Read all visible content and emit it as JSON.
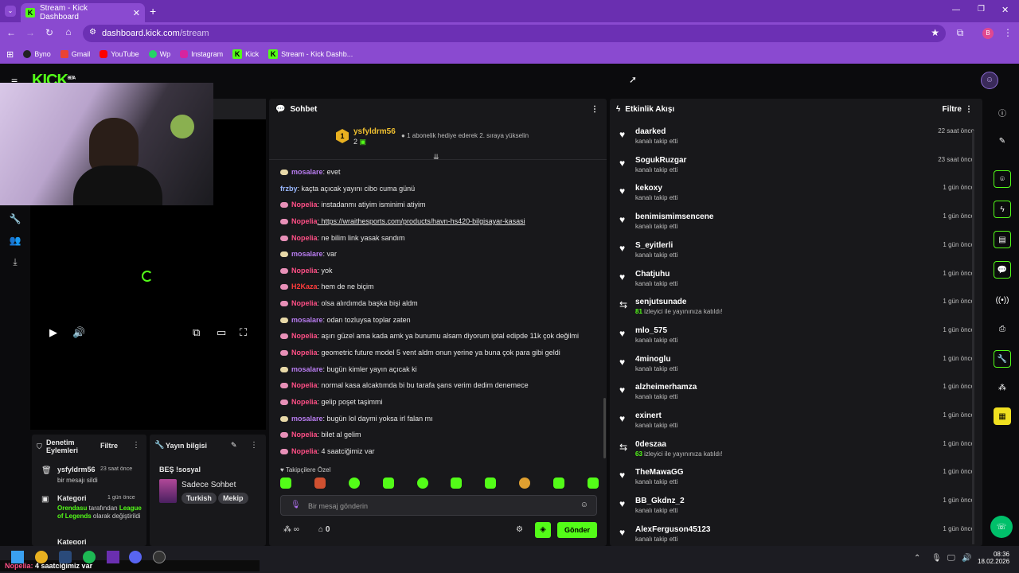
{
  "browser": {
    "tab_title": "Stream - Kick Dashboard",
    "url_host": "dashboard.kick.com",
    "url_path": "/stream",
    "profile_initial": "B",
    "bookmarks": [
      "Byno",
      "Gmail",
      "YouTube",
      "Wp",
      "Instagram",
      "Kick",
      "Stream - Kick Dashb..."
    ]
  },
  "kick": {
    "logo": "KICK",
    "logo_badge": "BETA"
  },
  "moderation": {
    "title": "Denetim Eylemleri",
    "filter": "Filtre",
    "items": [
      {
        "name": "ysfyldrm56",
        "time": "23 saat önce",
        "desc": "bir mesajı sildi"
      },
      {
        "name": "Kategori",
        "time": "1 gün önce",
        "desc_user": "Orendasu",
        "desc_mid": " tarafından ",
        "desc_cat": "League of Legends",
        "desc_end": " olarak değiştirildi"
      },
      {
        "name": "Kategori"
      }
    ]
  },
  "stream_info": {
    "title": "Yayın bilgisi",
    "stream_title": "BEŞ !sosyal",
    "category": "Sadece Sohbet",
    "tags": [
      "Turkish",
      "Mekip"
    ]
  },
  "chat": {
    "title": "Sohbet",
    "top_gifter": "ysfyldrm56",
    "top_gifter_count": "2",
    "top_gifter_rank": "1",
    "gift_prompt": "1 abonelik hediye ederek 2. sıraya yükselin",
    "messages": [
      {
        "user": "mosalare",
        "text": ": evet",
        "color": "#b87cf0",
        "badge": "#e8d9a8"
      },
      {
        "user": "frzby",
        "text": ": kaçta açıcak yayını cibo cuma günü",
        "color": "#9ab8ff",
        "badge": ""
      },
      {
        "user": "Nopelia",
        "text": ": instadanmı atiyim isminimi atiyim",
        "color": "#ff4f86",
        "badge": "#e890b8"
      },
      {
        "user": "Nopelia",
        "text": ": https://wraithesports.com/products/havn-hs420-bilgisayar-kasasi",
        "color": "#ff4f86",
        "badge": "#e890b8",
        "link": true
      },
      {
        "user": "Nopelia",
        "text": ": ne bilim link yasak sandım",
        "color": "#ff4f86",
        "badge": "#e890b8"
      },
      {
        "user": "mosalare",
        "text": ": var",
        "color": "#b87cf0",
        "badge": "#e8d9a8"
      },
      {
        "user": "Nopelia",
        "text": ": yok",
        "color": "#ff4f86",
        "badge": "#e890b8"
      },
      {
        "user": "H2Kaza",
        "text": ": hem de ne biçim",
        "color": "#ff3b3b",
        "badge": "#e890b8"
      },
      {
        "user": "Nopelia",
        "text": ": olsa alırdımda başka bişi aldm",
        "color": "#ff4f86",
        "badge": "#e890b8"
      },
      {
        "user": "mosalare",
        "text": ": odan tozluysa toplar zaten",
        "color": "#b87cf0",
        "badge": "#e8d9a8"
      },
      {
        "user": "Nopelia",
        "text": ": aşırı güzel ama kada amk ya bunumu alsam diyorum iptal edipde 11k çok değilmi",
        "color": "#ff4f86",
        "badge": "#e890b8"
      },
      {
        "user": "Nopelia",
        "text": ": geometric future model 5 vent aldm onun yerine ya buna çok para gibi geldi",
        "color": "#ff4f86",
        "badge": "#e890b8"
      },
      {
        "user": "mosalare",
        "text": ": bugün kimler yayın açıcak ki",
        "color": "#b87cf0",
        "badge": "#e8d9a8"
      },
      {
        "user": "Nopelia",
        "text": ": normal kasa alcaktımda bi bu tarafa şans verim dedim denemece",
        "color": "#ff4f86",
        "badge": "#e890b8"
      },
      {
        "user": "Nopelia",
        "text": ": gelip poşet taşimmi",
        "color": "#ff4f86",
        "badge": "#e890b8"
      },
      {
        "user": "mosalare",
        "text": ": bugün lol daymi yoksa irl falan mı",
        "color": "#b87cf0",
        "badge": "#e8d9a8"
      },
      {
        "user": "Nopelia",
        "text": ": bilet al gelim",
        "color": "#ff4f86",
        "badge": "#e890b8"
      },
      {
        "user": "Nopelia",
        "text": ": 4 saatciğimiz var",
        "color": "#ff4f86",
        "badge": "#e890b8"
      }
    ],
    "followers_only": "Takipçilere Özel",
    "input_placeholder": "Bir mesaj gönderin",
    "send": "Gönder",
    "viewer_count": "0"
  },
  "activity": {
    "title": "Etkinlik Akışı",
    "filter": "Filtre",
    "items": [
      {
        "name": "daarked",
        "sub": "kanalı takip etti",
        "time": "22 saat önce",
        "type": "follow"
      },
      {
        "name": "SogukRuzgar",
        "sub": "kanalı takip etti",
        "time": "23 saat önce",
        "type": "follow"
      },
      {
        "name": "kekoxy",
        "sub": "kanalı takip etti",
        "time": "1 gün önce",
        "type": "follow"
      },
      {
        "name": "benimismimsencene",
        "sub": "kanalı takip etti",
        "time": "1 gün önce",
        "type": "follow"
      },
      {
        "name": "S_eyitlerli",
        "sub": "kanalı takip etti",
        "time": "1 gün önce",
        "type": "follow"
      },
      {
        "name": "Chatjuhu",
        "sub": "kanalı takip etti",
        "time": "1 gün önce",
        "type": "follow"
      },
      {
        "name": "senjutsunade",
        "sub_count": "81",
        "sub": " izleyici ile yayınınıza katıldı!",
        "time": "1 gün önce",
        "type": "raid"
      },
      {
        "name": "mlo_575",
        "sub": "kanalı takip etti",
        "time": "1 gün önce",
        "type": "follow"
      },
      {
        "name": "4minoglu",
        "sub": "kanalı takip etti",
        "time": "1 gün önce",
        "type": "follow"
      },
      {
        "name": "alzheimerhamza",
        "sub": "kanalı takip etti",
        "time": "1 gün önce",
        "type": "follow"
      },
      {
        "name": "exinert",
        "sub": "kanalı takip etti",
        "time": "1 gün önce",
        "type": "follow"
      },
      {
        "name": "0deszaa",
        "sub_count": "63",
        "sub": " izleyici ile yayınınıza katıldı!",
        "time": "1 gün önce",
        "type": "raid"
      },
      {
        "name": "TheMawaGG",
        "sub": "kanalı takip etti",
        "time": "1 gün önce",
        "type": "follow"
      },
      {
        "name": "BB_Gkdnz_2",
        "sub": "kanalı takip etti",
        "time": "1 gün önce",
        "type": "follow"
      },
      {
        "name": "AlexFerguson45123",
        "sub": "kanalı takip etti",
        "time": "1 gün önce",
        "type": "follow"
      }
    ]
  },
  "taskbar": {
    "notification": "4 saatciğimiz var",
    "notification_user": "Nopelia:",
    "time": "08:36",
    "date": "18.02.2026"
  },
  "colors": {
    "kick_green": "#53fc18",
    "chrome_purple": "#8a4ad0",
    "panel_bg": "#18181b"
  }
}
